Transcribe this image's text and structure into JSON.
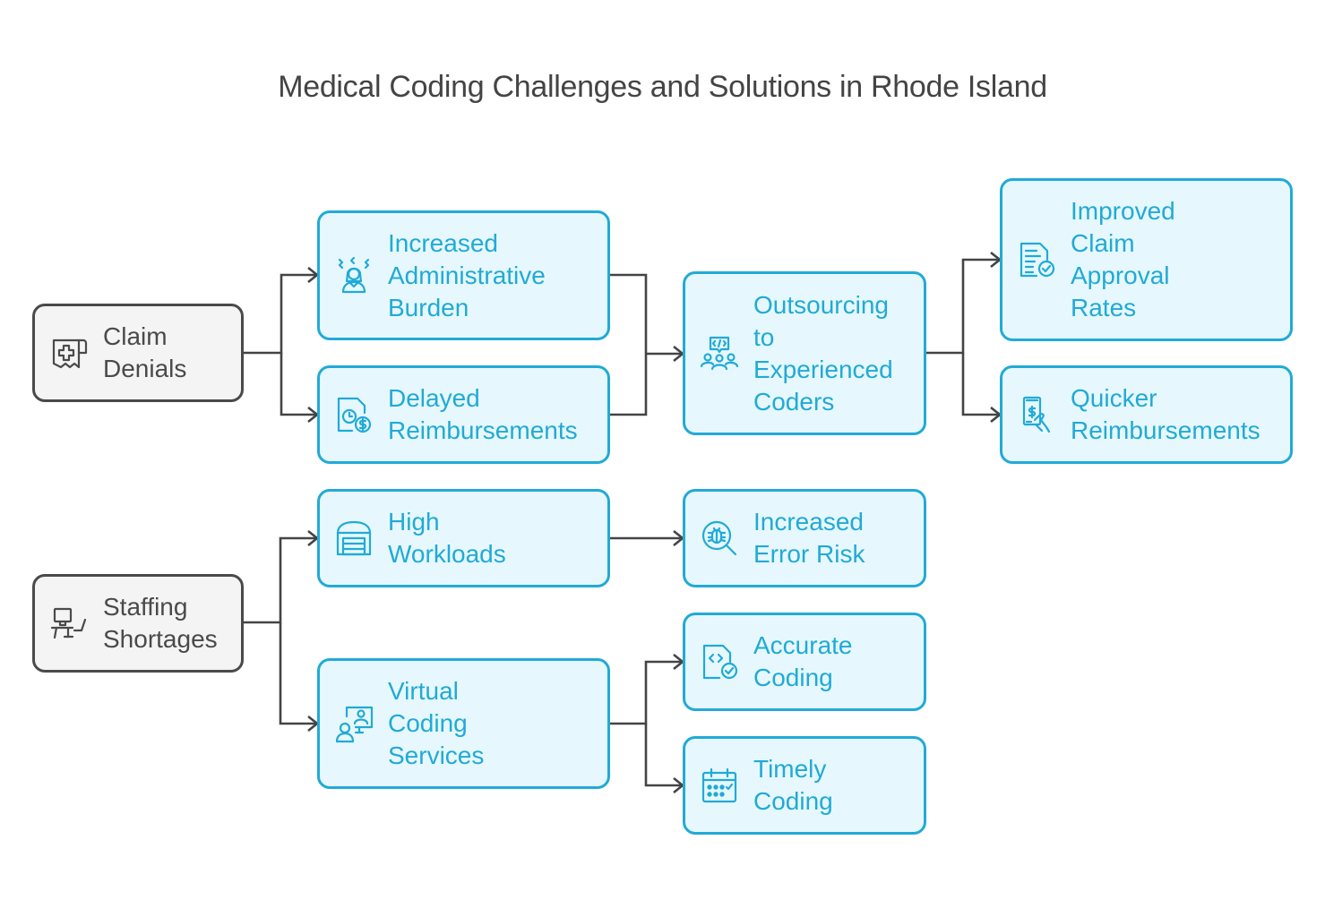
{
  "title": "Medical Coding Challenges and Solutions in Rhode Island",
  "colors": {
    "root_border": "#4a4a4a",
    "root_fill": "#f4f4f4",
    "node_border": "#21aad6",
    "node_fill": "#e6f8fd",
    "connector": "#444444",
    "title": "#444444"
  },
  "nodes": {
    "claim_denials": {
      "label": "Claim\nDenials",
      "icon": "medical-receipt-icon"
    },
    "admin_burden": {
      "label": "Increased\nAdministrative\nBurden",
      "icon": "stressed-person-icon"
    },
    "delayed_reimb": {
      "label": "Delayed\nReimbursements",
      "icon": "document-clock-dollar-icon"
    },
    "outsourcing": {
      "label": "Outsourcing\nto\nExperienced\nCoders",
      "icon": "team-code-icon"
    },
    "improved_claims": {
      "label": "Improved\nClaim\nApproval\nRates",
      "icon": "document-check-icon"
    },
    "quicker_reimb": {
      "label": "Quicker\nReimbursements",
      "icon": "hand-cash-icon"
    },
    "staffing": {
      "label": "Staffing\nShortages",
      "icon": "empty-desk-icon"
    },
    "high_workloads": {
      "label": "High\nWorkloads",
      "icon": "warehouse-icon"
    },
    "error_risk": {
      "label": "Increased\nError Risk",
      "icon": "bug-search-icon"
    },
    "virtual_coding": {
      "label": "Virtual\nCoding\nServices",
      "icon": "remote-meeting-icon"
    },
    "accurate_coding": {
      "label": "Accurate\nCoding",
      "icon": "code-file-check-icon"
    },
    "timely_coding": {
      "label": "Timely\nCoding",
      "icon": "calendar-check-icon"
    }
  },
  "edges": [
    {
      "from": "Claim Denials",
      "to": "Increased Administrative Burden"
    },
    {
      "from": "Claim Denials",
      "to": "Delayed Reimbursements"
    },
    {
      "from": "Increased Administrative Burden",
      "to": "Outsourcing to Experienced Coders"
    },
    {
      "from": "Delayed Reimbursements",
      "to": "Outsourcing to Experienced Coders"
    },
    {
      "from": "Outsourcing to Experienced Coders",
      "to": "Improved Claim Approval Rates"
    },
    {
      "from": "Outsourcing to Experienced Coders",
      "to": "Quicker Reimbursements"
    },
    {
      "from": "Staffing Shortages",
      "to": "High Workloads"
    },
    {
      "from": "Staffing Shortages",
      "to": "Virtual Coding Services"
    },
    {
      "from": "High Workloads",
      "to": "Increased Error Risk"
    },
    {
      "from": "Virtual Coding Services",
      "to": "Accurate Coding"
    },
    {
      "from": "Virtual Coding Services",
      "to": "Timely Coding"
    }
  ]
}
